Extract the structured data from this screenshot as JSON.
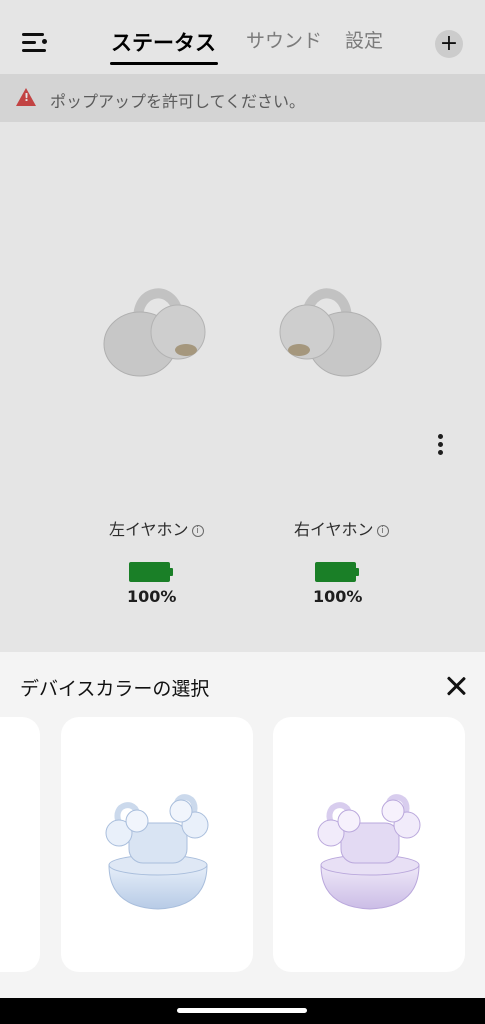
{
  "header": {
    "tabs": [
      {
        "label": "ステータス",
        "active": true
      },
      {
        "label": "サウンド",
        "active": false
      },
      {
        "label": "設定",
        "active": false
      }
    ],
    "add_icon": "plus-icon",
    "menu_icon": "menu-icon"
  },
  "notice": {
    "icon": "warning-icon",
    "text": "ポップアップを許可してください。",
    "icon_color": "#d94b4b"
  },
  "status": {
    "left": {
      "label": "左イヤホン",
      "battery": "100%",
      "battery_level": 1.0
    },
    "right": {
      "label": "右イヤホン",
      "battery": "100%",
      "battery_level": 1.0
    },
    "battery_color": "#1e8e2c",
    "more_icon": "more-vertical-icon"
  },
  "sheet": {
    "title": "デバイスカラーの選択",
    "close_icon": "close-icon",
    "options": [
      {
        "name": "blue",
        "color": "#c9d9ee"
      },
      {
        "name": "purple",
        "color": "#ddd2ee"
      }
    ]
  }
}
